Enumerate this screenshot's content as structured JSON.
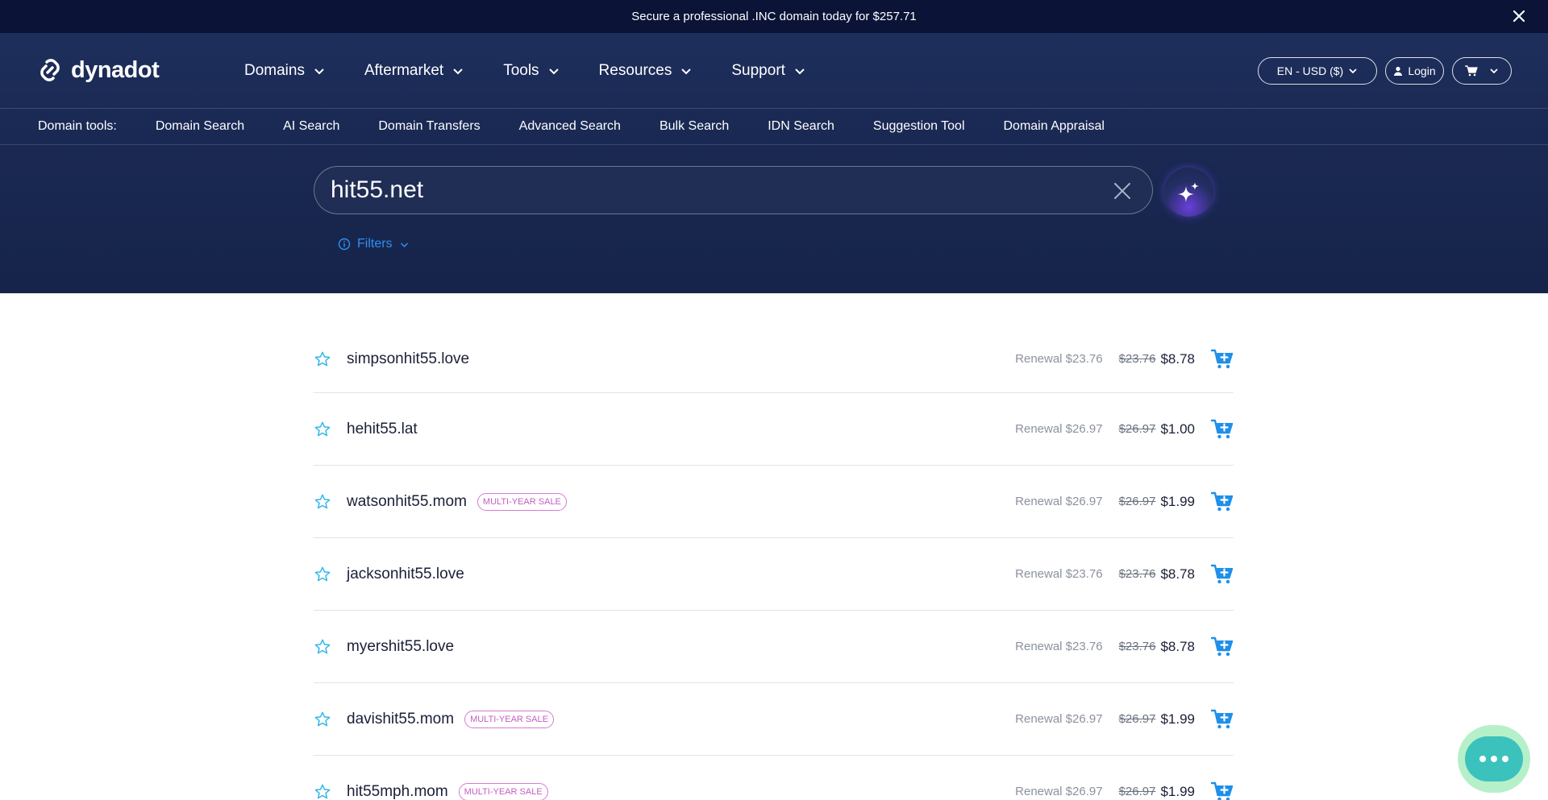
{
  "promo": {
    "text": "Secure a professional .INC domain today for $257.71"
  },
  "brand": {
    "name": "dynadot"
  },
  "main_menu": [
    {
      "label": "Domains"
    },
    {
      "label": "Aftermarket"
    },
    {
      "label": "Tools"
    },
    {
      "label": "Resources"
    },
    {
      "label": "Support"
    }
  ],
  "right_nav": {
    "language": "EN - USD ($)",
    "login": "Login"
  },
  "domain_tools": {
    "label": "Domain tools:",
    "items": [
      "Domain Search",
      "AI Search",
      "Domain Transfers",
      "Advanced Search",
      "Bulk Search",
      "IDN Search",
      "Suggestion Tool",
      "Domain Appraisal"
    ]
  },
  "search": {
    "value": "hit55.net"
  },
  "filters": {
    "label": "Filters"
  },
  "results": [
    {
      "domain": "simpsonhit55.love",
      "badge": "",
      "renewal": "Renewal $23.76",
      "old_price": "$23.76",
      "price": "$8.78"
    },
    {
      "domain": "hehit55.lat",
      "badge": "",
      "renewal": "Renewal $26.97",
      "old_price": "$26.97",
      "price": "$1.00"
    },
    {
      "domain": "watsonhit55.mom",
      "badge": "MULTI-YEAR SALE",
      "renewal": "Renewal $26.97",
      "old_price": "$26.97",
      "price": "$1.99"
    },
    {
      "domain": "jacksonhit55.love",
      "badge": "",
      "renewal": "Renewal $23.76",
      "old_price": "$23.76",
      "price": "$8.78"
    },
    {
      "domain": "myershit55.love",
      "badge": "",
      "renewal": "Renewal $23.76",
      "old_price": "$23.76",
      "price": "$8.78"
    },
    {
      "domain": "davishit55.mom",
      "badge": "MULTI-YEAR SALE",
      "renewal": "Renewal $26.97",
      "old_price": "$26.97",
      "price": "$1.99"
    },
    {
      "domain": "hit55mph.mom",
      "badge": "MULTI-YEAR SALE",
      "renewal": "Renewal $26.97",
      "old_price": "$26.97",
      "price": "$1.99"
    }
  ],
  "colors": {
    "navy": "#0b1437",
    "hero": "#1b2a55",
    "accent_blue": "#2f8ff0",
    "badge_pink": "#c45ec1",
    "chat_teal": "#3bc2bd"
  },
  "icons": [
    "close-icon",
    "logo-icon",
    "chevron-down-icon",
    "user-icon",
    "cart-icon",
    "clear-icon",
    "sparkle-icon",
    "info-icon",
    "star-icon",
    "add-to-cart-icon",
    "chat-icon"
  ]
}
